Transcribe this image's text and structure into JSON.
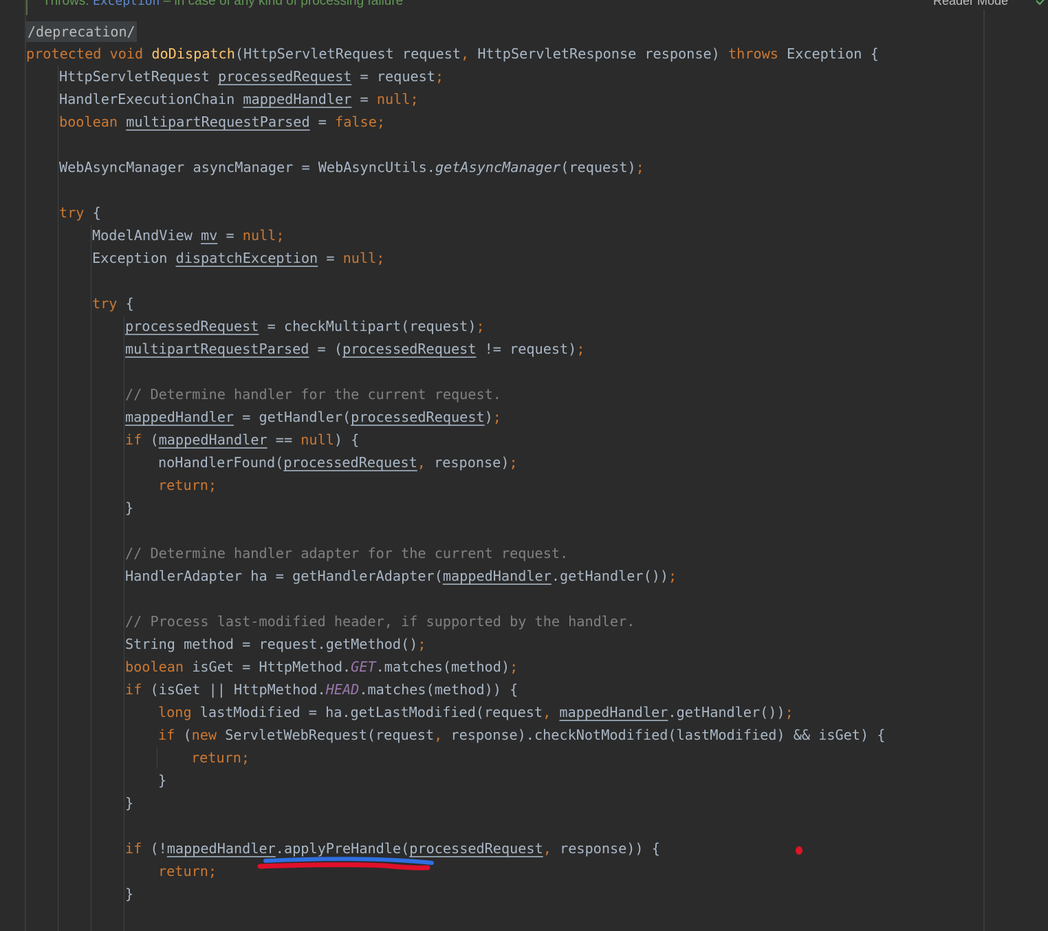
{
  "header": {
    "javadoc_throws_label": "Throws:",
    "javadoc_exception": "Exception",
    "javadoc_description": " – in case of any kind of processing failure",
    "reader_mode": "Reader Mode"
  },
  "annotation_tag": "/deprecation/",
  "lines": [
    [
      {
        "t": "protected void ",
        "c": "kw"
      },
      {
        "t": "doDispatch",
        "c": "fn"
      },
      {
        "t": "(HttpServletRequest request"
      },
      {
        "t": ", ",
        "c": "kw"
      },
      {
        "t": "HttpServletResponse response) "
      },
      {
        "t": "throws ",
        "c": "kw"
      },
      {
        "t": "Exception {"
      }
    ],
    [
      {
        "t": "HttpServletRequest "
      },
      {
        "t": "processedRequest",
        "c": "ul"
      },
      {
        "t": " = request"
      },
      {
        "t": ";",
        "c": "kw"
      }
    ],
    [
      {
        "t": "HandlerExecutionChain "
      },
      {
        "t": "mappedHandler",
        "c": "ul"
      },
      {
        "t": " = "
      },
      {
        "t": "null;",
        "c": "kw"
      }
    ],
    [
      {
        "t": "boolean ",
        "c": "kw"
      },
      {
        "t": "multipartRequestParsed",
        "c": "ul"
      },
      {
        "t": " = "
      },
      {
        "t": "false;",
        "c": "kw"
      }
    ],
    [],
    [
      {
        "t": "WebAsyncManager asyncManager = WebAsyncUtils."
      },
      {
        "t": "getAsyncManager",
        "c": "it"
      },
      {
        "t": "(request)"
      },
      {
        "t": ";",
        "c": "kw"
      }
    ],
    [],
    [
      {
        "t": "try ",
        "c": "kw"
      },
      {
        "t": "{"
      }
    ],
    [
      {
        "t": "ModelAndView "
      },
      {
        "t": "mv",
        "c": "ul"
      },
      {
        "t": " = "
      },
      {
        "t": "null;",
        "c": "kw"
      }
    ],
    [
      {
        "t": "Exception "
      },
      {
        "t": "dispatchException",
        "c": "ul"
      },
      {
        "t": " = "
      },
      {
        "t": "null;",
        "c": "kw"
      }
    ],
    [],
    [
      {
        "t": "try ",
        "c": "kw"
      },
      {
        "t": "{"
      }
    ],
    [
      {
        "t": "processedRequest",
        "c": "ul"
      },
      {
        "t": " = checkMultipart(request)"
      },
      {
        "t": ";",
        "c": "kw"
      }
    ],
    [
      {
        "t": "multipartRequestParsed",
        "c": "ul"
      },
      {
        "t": " = ("
      },
      {
        "t": "processedRequest",
        "c": "ul"
      },
      {
        "t": " != request)"
      },
      {
        "t": ";",
        "c": "kw"
      }
    ],
    [],
    [
      {
        "t": "// Determine handler for the current request.",
        "c": "cm"
      }
    ],
    [
      {
        "t": "mappedHandler",
        "c": "ul"
      },
      {
        "t": " = getHandler("
      },
      {
        "t": "processedRequest",
        "c": "ul"
      },
      {
        "t": ")"
      },
      {
        "t": ";",
        "c": "kw"
      }
    ],
    [
      {
        "t": "if ",
        "c": "kw"
      },
      {
        "t": "("
      },
      {
        "t": "mappedHandler",
        "c": "ul"
      },
      {
        "t": " == "
      },
      {
        "t": "null",
        "c": "kw"
      },
      {
        "t": ") {"
      }
    ],
    [
      {
        "t": "noHandlerFound("
      },
      {
        "t": "processedRequest",
        "c": "ul"
      },
      {
        "t": ", ",
        "c": "kw"
      },
      {
        "t": "response)"
      },
      {
        "t": ";",
        "c": "kw"
      }
    ],
    [
      {
        "t": "return;",
        "c": "kw"
      }
    ],
    [
      {
        "t": "}"
      }
    ],
    [],
    [
      {
        "t": "// Determine handler adapter for the current request.",
        "c": "cm"
      }
    ],
    [
      {
        "t": "HandlerAdapter ha = getHandlerAdapter("
      },
      {
        "t": "mappedHandler",
        "c": "ul"
      },
      {
        "t": ".getHandler())"
      },
      {
        "t": ";",
        "c": "kw"
      }
    ],
    [],
    [
      {
        "t": "// Process last-modified header, if supported by the handler.",
        "c": "cm"
      }
    ],
    [
      {
        "t": "String method = request.getMethod()"
      },
      {
        "t": ";",
        "c": "kw"
      }
    ],
    [
      {
        "t": "boolean ",
        "c": "kw"
      },
      {
        "t": "isGet = HttpMethod."
      },
      {
        "t": "GET",
        "c": "st"
      },
      {
        "t": ".matches(method)"
      },
      {
        "t": ";",
        "c": "kw"
      }
    ],
    [
      {
        "t": "if ",
        "c": "kw"
      },
      {
        "t": "(isGet || HttpMethod."
      },
      {
        "t": "HEAD",
        "c": "st"
      },
      {
        "t": ".matches(method)) {"
      }
    ],
    [
      {
        "t": "long ",
        "c": "kw"
      },
      {
        "t": "lastModified = ha.getLastModified(request"
      },
      {
        "t": ", ",
        "c": "kw"
      },
      {
        "t": "mappedHandler",
        "c": "ul"
      },
      {
        "t": ".getHandler())"
      },
      {
        "t": ";",
        "c": "kw"
      }
    ],
    [
      {
        "t": "if ",
        "c": "kw"
      },
      {
        "t": "("
      },
      {
        "t": "new ",
        "c": "kw"
      },
      {
        "t": "ServletWebRequest(request"
      },
      {
        "t": ", ",
        "c": "kw"
      },
      {
        "t": "response).checkNotModified(lastModified) && isGet) {"
      }
    ],
    [
      {
        "t": "return;",
        "c": "kw"
      }
    ],
    [
      {
        "t": "}"
      }
    ],
    [
      {
        "t": "}"
      }
    ],
    [],
    [
      {
        "t": "if ",
        "c": "kw"
      },
      {
        "t": "(!"
      },
      {
        "t": "mappedHandler",
        "c": "ul"
      },
      {
        "t": ".applyPreHandle("
      },
      {
        "t": "processedRequest",
        "c": "ul"
      },
      {
        "t": ", ",
        "c": "kw"
      },
      {
        "t": "response)) {"
      }
    ],
    [
      {
        "t": "return;",
        "c": "kw"
      }
    ],
    [
      {
        "t": "}"
      }
    ]
  ]
}
